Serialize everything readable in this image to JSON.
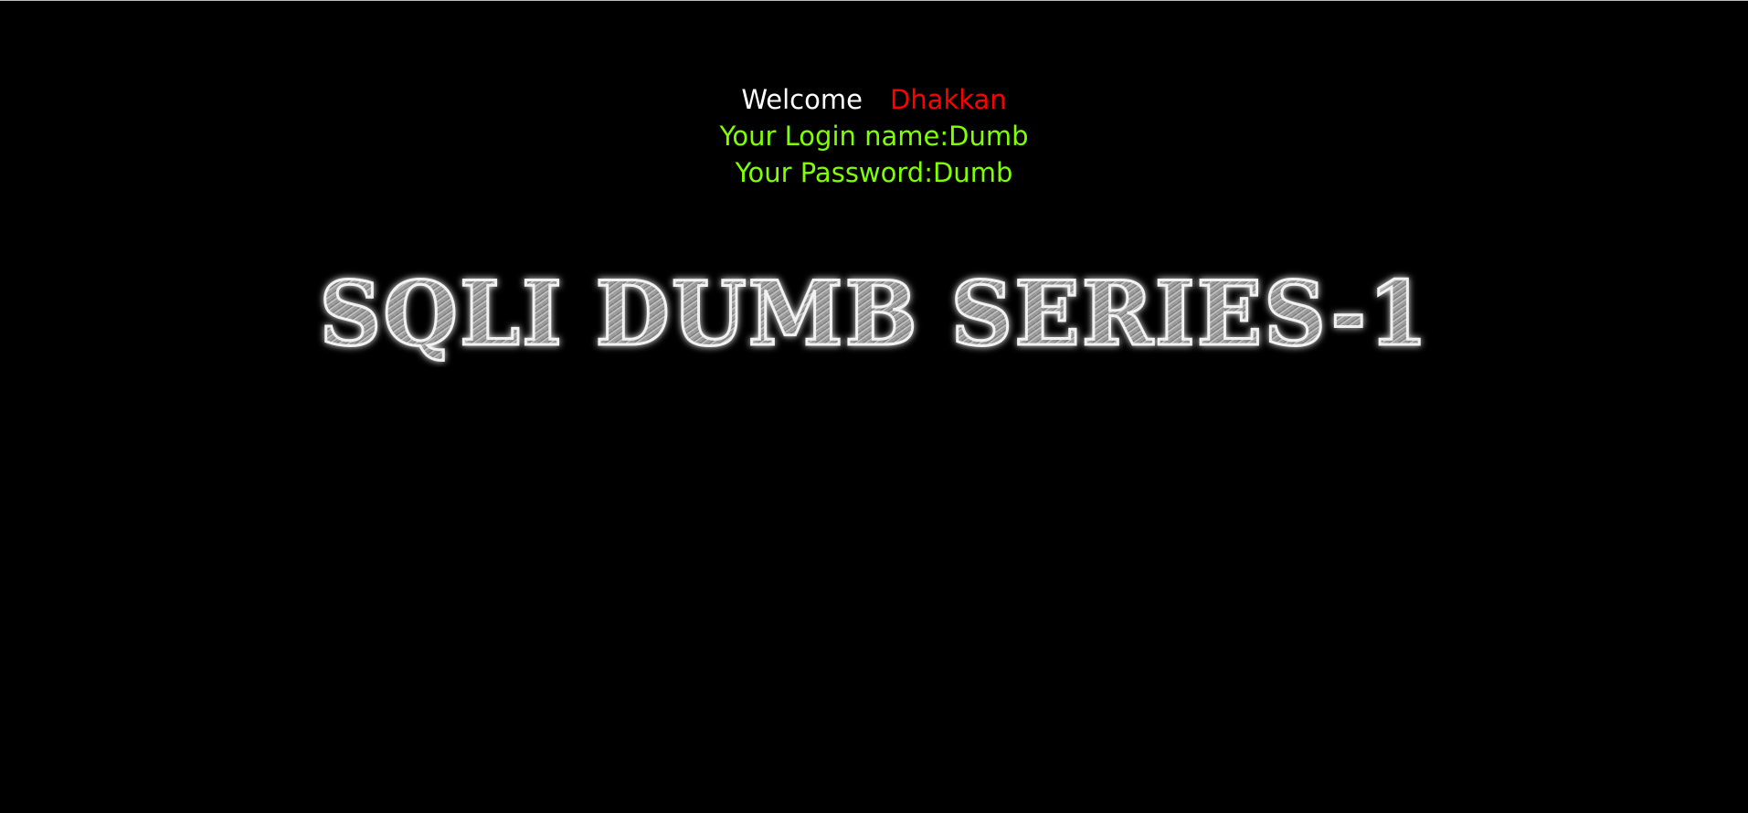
{
  "welcome": {
    "greeting": "Welcome",
    "name": "Dhakkan"
  },
  "login": {
    "login_name_line": "Your Login name:Dumb",
    "password_line": "Your Password:Dumb"
  },
  "banner": {
    "title": "SQLI DUMB SERIES-1"
  },
  "colors": {
    "background": "#000000",
    "greeting": "#ffffff",
    "name": "#ff0000",
    "info": "#7fff00",
    "banner_fill": "#9a9a9a",
    "banner_glow": "#ffffff"
  }
}
